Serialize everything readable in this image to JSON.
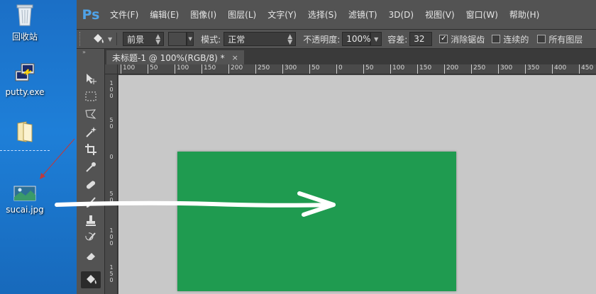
{
  "desktop": {
    "icons": [
      {
        "label": "回收站",
        "icon": "recycle-bin-icon"
      },
      {
        "label": "putty.exe",
        "icon": "putty-icon"
      },
      {
        "label": "",
        "icon": "folder-icon"
      },
      {
        "label": "sucai.jpg",
        "icon": "image-file-icon"
      }
    ]
  },
  "app": {
    "logo": "Ps",
    "menu": [
      "文件(F)",
      "编辑(E)",
      "图像(I)",
      "图层(L)",
      "文字(Y)",
      "选择(S)",
      "滤镜(T)",
      "3D(D)",
      "视图(V)",
      "窗口(W)",
      "帮助(H)"
    ]
  },
  "options": {
    "fill_source": "前景",
    "mode_label": "模式:",
    "mode_value": "正常",
    "opacity_label": "不透明度:",
    "opacity_value": "100%",
    "tolerance_label": "容差:",
    "tolerance_value": "32",
    "antialias_label": "消除锯齿",
    "antialias_checked": true,
    "contiguous_label": "连续的",
    "contiguous_checked": false,
    "all_layers_label": "所有图层",
    "all_layers_checked": false
  },
  "document": {
    "tab_title": "未标题-1 @ 100%(RGB/8) *",
    "close_glyph": "×",
    "fill_color": "#1f9b50"
  },
  "rulers": {
    "horizontal": [
      "100",
      "50",
      "100",
      "150",
      "200",
      "250",
      "300",
      "50",
      "0",
      "50",
      "100",
      "150",
      "200",
      "250",
      "300",
      "350",
      "400",
      "450"
    ],
    "vertical": [
      "1\n0\n0",
      "5\n0",
      "0",
      "5\n0",
      "1\n0\n0",
      "1\n5\n0"
    ]
  },
  "tools": [
    "move-tool-icon",
    "marquee-tool-icon",
    "lasso-tool-icon",
    "magic-wand-tool-icon",
    "crop-tool-icon",
    "eyedropper-tool-icon",
    "healing-brush-tool-icon",
    "brush-tool-icon",
    "clone-stamp-tool-icon",
    "history-brush-tool-icon",
    "eraser-tool-icon",
    "paint-bucket-tool-icon"
  ]
}
